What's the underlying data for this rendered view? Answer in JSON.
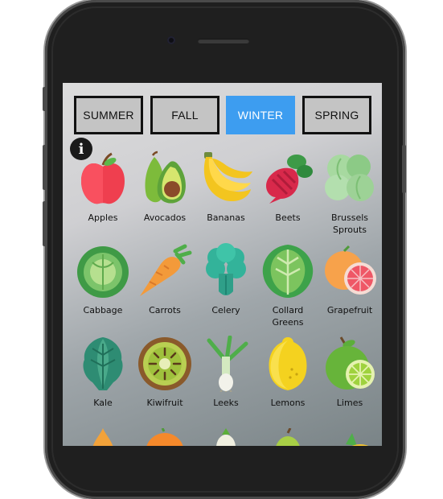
{
  "tabs": [
    {
      "label": "SUMMER"
    },
    {
      "label": "FALL"
    },
    {
      "label": "WINTER",
      "active": true
    },
    {
      "label": "SPRING"
    }
  ],
  "info_button": {
    "glyph": "i"
  },
  "produce": [
    {
      "label": "Apples",
      "icon": "apple-icon"
    },
    {
      "label": "Avocados",
      "icon": "avocado-icon"
    },
    {
      "label": "Bananas",
      "icon": "banana-icon"
    },
    {
      "label": "Beets",
      "icon": "beet-icon"
    },
    {
      "label": "Brussels\nSprouts",
      "icon": "brussels-sprouts-icon"
    },
    {
      "label": "Cabbage",
      "icon": "cabbage-icon"
    },
    {
      "label": "Carrots",
      "icon": "carrot-icon"
    },
    {
      "label": "Celery",
      "icon": "celery-icon"
    },
    {
      "label": "Collard\nGreens",
      "icon": "collard-greens-icon"
    },
    {
      "label": "Grapefruit",
      "icon": "grapefruit-icon"
    },
    {
      "label": "Kale",
      "icon": "kale-icon"
    },
    {
      "label": "Kiwifruit",
      "icon": "kiwifruit-icon"
    },
    {
      "label": "Leeks",
      "icon": "leek-icon"
    },
    {
      "label": "Lemons",
      "icon": "lemon-icon"
    },
    {
      "label": "Limes",
      "icon": "lime-icon"
    }
  ],
  "colors": {
    "active_tab": "#3d9df0",
    "tab_bg": "#c4c4c4"
  }
}
